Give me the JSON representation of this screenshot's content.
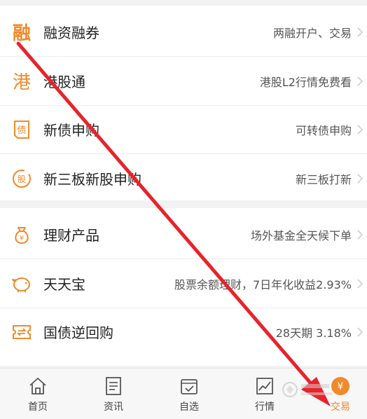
{
  "menu_group_1": [
    {
      "icon_char": "融",
      "title": "融资融券",
      "desc": "两融开户、交易"
    },
    {
      "icon_char": "港",
      "title": "港股通",
      "desc": "港股L2行情免费看"
    },
    {
      "icon_char": "",
      "title": "新债申购",
      "desc": "可转债申购"
    },
    {
      "icon_char": "",
      "title": "新三板新股申购",
      "desc": "新三板打新"
    }
  ],
  "menu_group_2": [
    {
      "title": "理财产品",
      "desc": "场外基金全天候下单"
    },
    {
      "title": "天天宝",
      "desc": "股票余额理财，7日年化收益2.93%"
    },
    {
      "title": "国债逆回购",
      "desc": "28天期 3.18%"
    }
  ],
  "tabbar": {
    "home": "首页",
    "news": "资讯",
    "watchlist": "自选",
    "market": "行情",
    "trade": "交易"
  },
  "colors": {
    "accent": "#f08a2a",
    "annotation_arrow": "#e8232a"
  }
}
